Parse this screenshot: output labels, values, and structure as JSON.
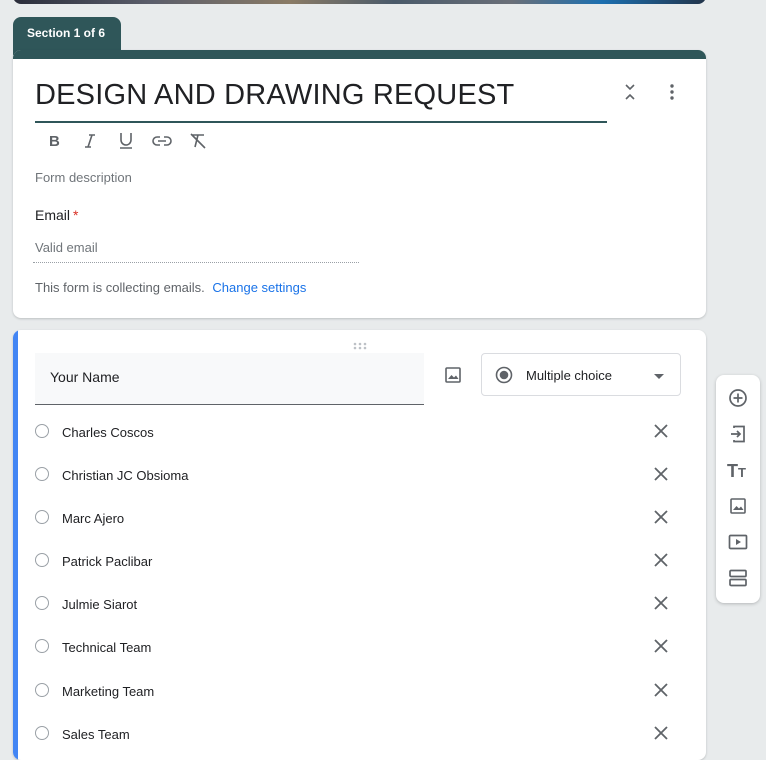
{
  "section_tab": {
    "label": "Section 1 of 6"
  },
  "header": {
    "title": "DESIGN AND DRAWING REQUEST",
    "description_placeholder": "Form description",
    "formatting": [
      "bold-icon",
      "italic-icon",
      "underline-icon",
      "link-icon",
      "clear-format-icon"
    ]
  },
  "email": {
    "label": "Email",
    "required_mark": "*",
    "placeholder": "Valid email",
    "collecting_text": "This form is collecting emails.",
    "change_settings": "Change settings"
  },
  "question": {
    "title": "Your Name",
    "type": "Multiple choice",
    "options": [
      "Charles Coscos",
      "Christian JC Obsioma",
      "Marc Ajero",
      "Patrick Paclibar",
      "Julmie Siarot",
      "Technical Team",
      "Marketing Team",
      "Sales Team"
    ]
  },
  "toolbar": [
    "add-question-icon",
    "import-questions-icon",
    "add-title-icon",
    "add-image-icon",
    "add-video-icon",
    "add-section-icon"
  ],
  "colors": {
    "accent": "#2f5659",
    "question_accent": "#4285f4",
    "link": "#1a73e8",
    "required": "#d93025"
  }
}
